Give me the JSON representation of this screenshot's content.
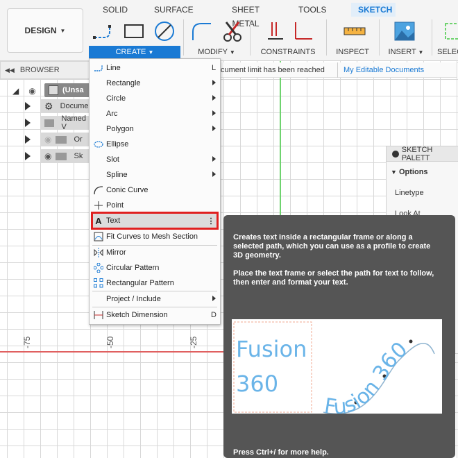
{
  "toolbar": {
    "design_label": "DESIGN",
    "tabs": [
      "SOLID",
      "SURFACE",
      "SHEET METAL",
      "TOOLS",
      "SKETCH"
    ],
    "groups": [
      "CREATE",
      "MODIFY",
      "CONSTRAINTS",
      "INSPECT",
      "INSERT",
      "SELEC"
    ]
  },
  "browser": {
    "header": "BROWSER",
    "items": [
      "(Unsa",
      "Docume",
      "Named V",
      "Or",
      "Sk"
    ]
  },
  "notice": {
    "text": "cument limit has been reached",
    "link": "My Editable Documents"
  },
  "palette": {
    "header": "SKETCH PALETT",
    "options_label": "Options",
    "rows": [
      "Linetype",
      "Look At"
    ]
  },
  "canvas": {
    "ruler_labels": [
      "-75",
      "-50",
      "-25"
    ]
  },
  "menu": {
    "items": [
      {
        "label": "Line",
        "shortcut": "L",
        "icon": "line-icon"
      },
      {
        "label": "Rectangle",
        "submenu": true
      },
      {
        "label": "Circle",
        "submenu": true
      },
      {
        "label": "Arc",
        "submenu": true
      },
      {
        "label": "Polygon",
        "submenu": true
      },
      {
        "label": "Ellipse",
        "icon": "ellipse-icon"
      },
      {
        "label": "Slot",
        "submenu": true
      },
      {
        "label": "Spline",
        "submenu": true
      },
      {
        "label": "Conic Curve",
        "icon": "conic-curve-icon"
      },
      {
        "label": "Point",
        "icon": "point-icon"
      },
      {
        "label": "Text",
        "icon": "text-icon",
        "highlighted": true
      },
      {
        "label": "Fit Curves to Mesh Section",
        "icon": "fit-curves-icon"
      },
      {
        "label": "Mirror",
        "icon": "mirror-icon"
      },
      {
        "label": "Circular Pattern",
        "icon": "circular-pattern-icon"
      },
      {
        "label": "Rectangular Pattern",
        "icon": "rectangular-pattern-icon"
      },
      {
        "label": "Project / Include",
        "submenu": true
      },
      {
        "label": "Sketch Dimension",
        "shortcut": "D",
        "icon": "sketch-dimension-icon"
      }
    ],
    "highlight_color": "#e02020"
  },
  "tooltip": {
    "para1": "Creates text inside a rectangular frame or along a selected path, which you can use as a profile to create 3D geometry.",
    "para2": "Place the text frame or select the path for text to follow, then enter and format your text.",
    "sample_line1": "Fusion",
    "sample_line2": "360",
    "sample_path_text": "Fusion 360",
    "footer": "Press Ctrl+/ for more help."
  },
  "colors": {
    "accent": "#1a7ad4",
    "tooltip_bg": "#555555",
    "sample_text": "#6ab4e8"
  }
}
